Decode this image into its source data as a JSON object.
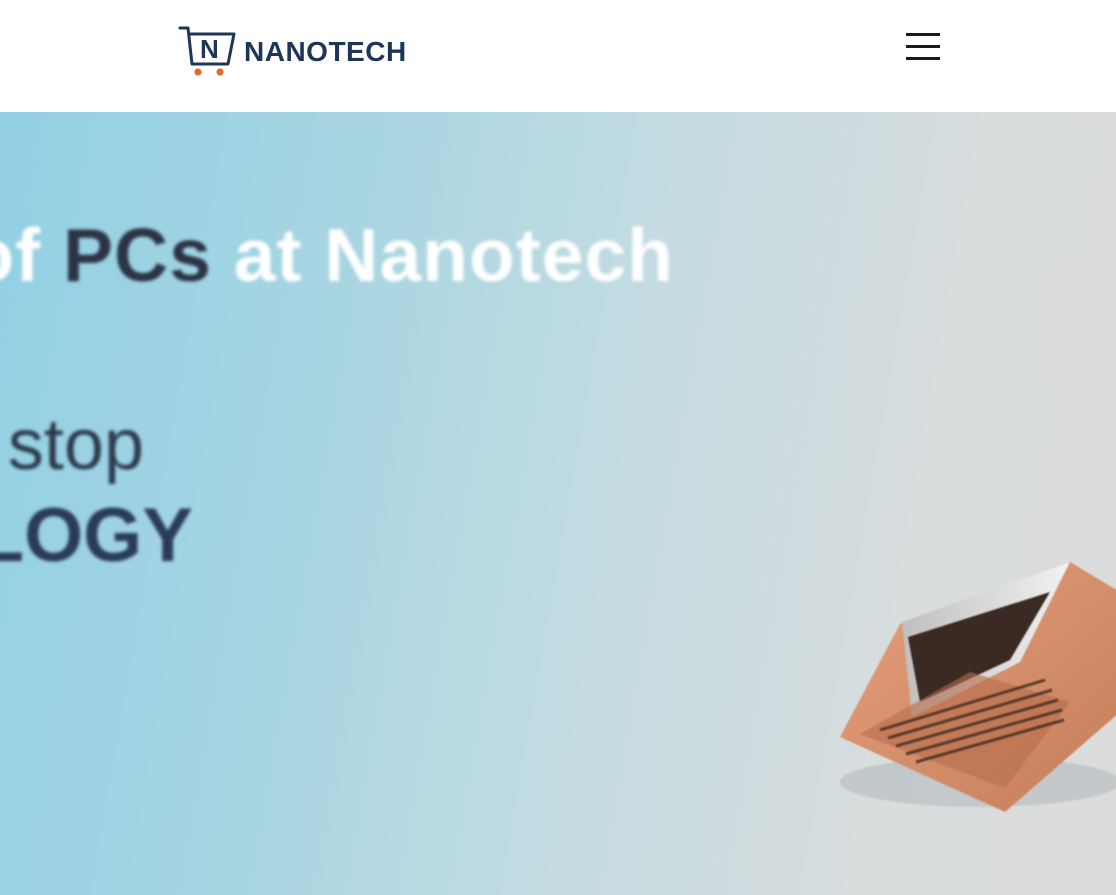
{
  "header": {
    "logo_text": "NANOTECH",
    "logo_mark_letter": "N",
    "menu_icon": "hamburger-menu-icon"
  },
  "hero": {
    "line1_a": "t of ",
    "line1_b": "PCs",
    "line1_c": " at Nanotech",
    "line2": "stop",
    "line3": "OLOGY"
  },
  "colors": {
    "brand_navy": "#1f3558",
    "brand_orange": "#e56a2a",
    "hero_gradient_start": "#92d0e4",
    "hero_gradient_end": "#dcdcdc",
    "laptop": "#d9926e"
  }
}
